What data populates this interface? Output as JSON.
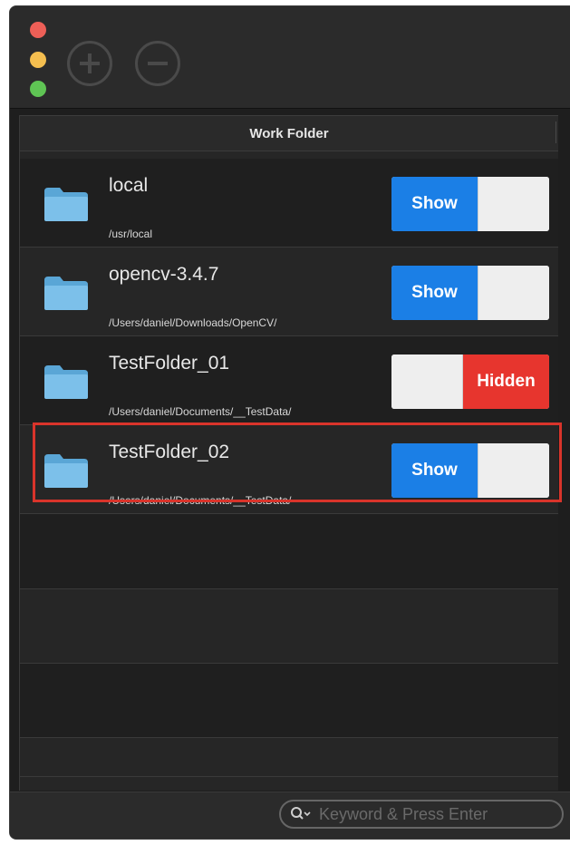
{
  "toolbar": {
    "add_icon": "plus-circle-icon",
    "remove_icon": "minus-circle-icon"
  },
  "table": {
    "header": "Work Folder",
    "rows": [
      {
        "name": "local",
        "path": "/usr/local",
        "state": "Show"
      },
      {
        "name": "opencv-3.4.7",
        "path": "/Users/daniel/Downloads/OpenCV/",
        "state": "Show"
      },
      {
        "name": "TestFolder_01",
        "path": "/Users/daniel/Documents/__TestData/",
        "state": "Hidden"
      },
      {
        "name": "TestFolder_02",
        "path": "/Users/daniel/Documents/__TestData/",
        "state": "Show"
      }
    ]
  },
  "search": {
    "placeholder": "Keyword & Press Enter",
    "value": ""
  },
  "colors": {
    "show": "#1b7fe6",
    "hidden": "#e7352e",
    "highlight": "#d9342b"
  }
}
